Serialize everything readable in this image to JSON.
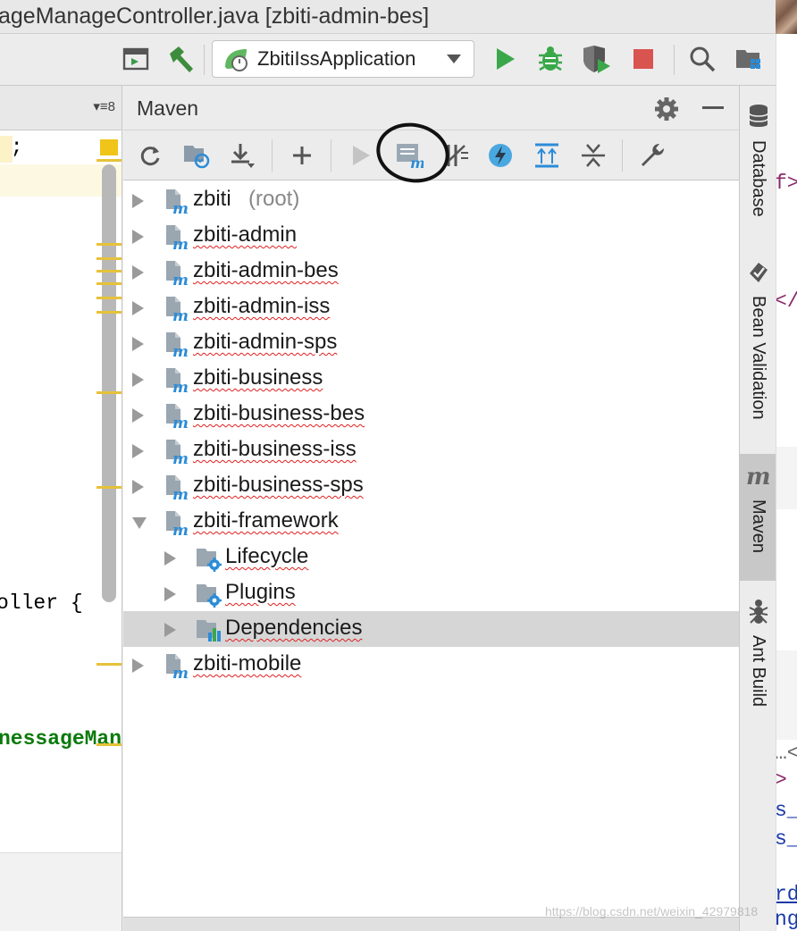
{
  "window": {
    "title": "ageManageController.java [zbiti-admin-bes]"
  },
  "toolbar": {
    "run_config": "ZbitiIssApplication",
    "icons": [
      "build-layout-icon",
      "hammer-icon",
      "spring-boot-icon",
      "run-icon",
      "debug-icon",
      "coverage-icon",
      "stop-icon",
      "search-icon",
      "project-structure-icon"
    ]
  },
  "editor": {
    "tab_control": "▾≡8",
    "lines": [
      {
        "text": "e;"
      },
      {
        "text": "oller {"
      },
      {
        "text": "nessageMana"
      }
    ]
  },
  "maven": {
    "title": "Maven",
    "tools": [
      "reload-icon",
      "generate-sources-icon",
      "download-icon",
      "add-icon",
      "run-icon",
      "execute-goal-icon",
      "toggle-offline-icon",
      "skip-tests-icon",
      "show-dependencies-icon",
      "collapse-all-icon",
      "settings-wrench-icon"
    ],
    "tree": [
      {
        "label": "zbiti",
        "suffix": "(root)",
        "level": 0,
        "expanded": false,
        "type": "module"
      },
      {
        "label": "zbiti-admin",
        "level": 0,
        "expanded": false,
        "type": "module"
      },
      {
        "label": "zbiti-admin-bes",
        "level": 0,
        "expanded": false,
        "type": "module"
      },
      {
        "label": "zbiti-admin-iss",
        "level": 0,
        "expanded": false,
        "type": "module"
      },
      {
        "label": "zbiti-admin-sps",
        "level": 0,
        "expanded": false,
        "type": "module"
      },
      {
        "label": "zbiti-business",
        "level": 0,
        "expanded": false,
        "type": "module"
      },
      {
        "label": "zbiti-business-bes",
        "level": 0,
        "expanded": false,
        "type": "module"
      },
      {
        "label": "zbiti-business-iss",
        "level": 0,
        "expanded": false,
        "type": "module"
      },
      {
        "label": "zbiti-business-sps",
        "level": 0,
        "expanded": false,
        "type": "module"
      },
      {
        "label": "zbiti-framework",
        "level": 0,
        "expanded": true,
        "type": "module"
      },
      {
        "label": "Lifecycle",
        "level": 1,
        "expanded": false,
        "type": "folder-gear"
      },
      {
        "label": "Plugins",
        "level": 1,
        "expanded": false,
        "type": "folder-gear"
      },
      {
        "label": "Dependencies",
        "level": 1,
        "expanded": false,
        "type": "folder-chart",
        "selected": true
      },
      {
        "label": "zbiti-mobile",
        "level": 0,
        "expanded": false,
        "type": "module"
      }
    ]
  },
  "tool_strip": {
    "tabs": [
      {
        "label": "Database",
        "icon": "database-icon"
      },
      {
        "label": "Bean Validation",
        "icon": "bean-icon"
      },
      {
        "label": "Maven",
        "icon": "maven-icon",
        "active": true
      },
      {
        "label": "Ant Build",
        "icon": "ant-icon"
      }
    ]
  },
  "peek": {
    "lines": [
      "f>",
      "</",
      "…<",
      ">",
      "s_",
      "s_",
      "rd",
      "ng"
    ]
  },
  "watermark": "https://blog.csdn.net/weixin_42979818"
}
